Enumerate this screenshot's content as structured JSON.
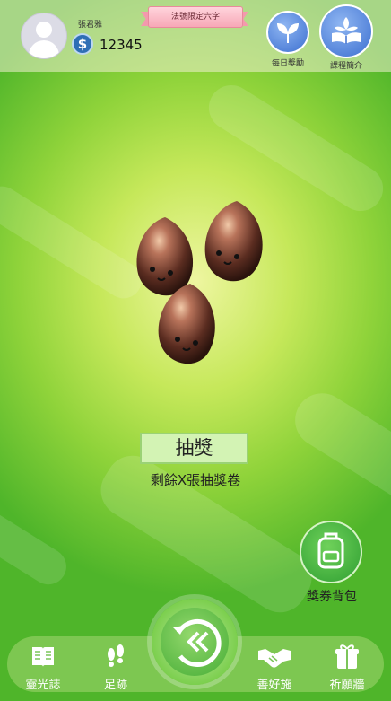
{
  "header": {
    "username": "張君雅",
    "coin_balance": "12345",
    "banner_text": "法號限定六字",
    "daily_reward_label": "每日獎勵",
    "course_intro_label": "課程簡介"
  },
  "main": {
    "draw_button_label": "抽獎",
    "remaining_text": "剩餘X張抽獎卷",
    "voucher_bag_label": "獎券背包"
  },
  "bottom_nav": {
    "items": [
      {
        "label": "靈光誌",
        "icon": "book-icon"
      },
      {
        "label": "足跡",
        "icon": "footprints-icon"
      },
      {
        "label": "",
        "icon": "back-rewind-icon"
      },
      {
        "label": "善好施",
        "icon": "handshake-icon"
      },
      {
        "label": "祈願牆",
        "icon": "gift-box-icon"
      }
    ]
  },
  "colors": {
    "accent_blue": "#3c6fd0",
    "accent_green": "#46ad36",
    "ribbon_pink": "#f7a8b7"
  }
}
